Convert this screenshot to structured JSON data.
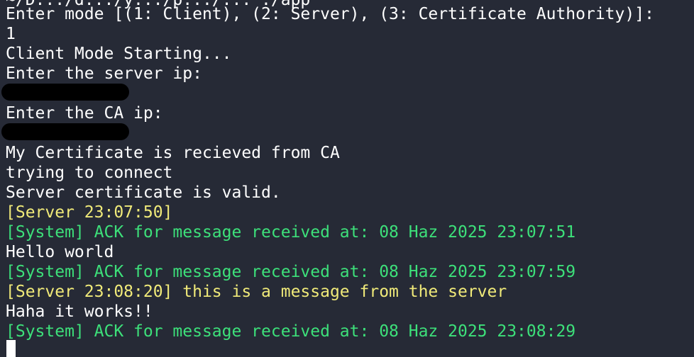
{
  "colors": {
    "background": "#262a36",
    "text": "#ffffff",
    "server_text": "#f0ea79",
    "system_text": "#3de07a",
    "redaction": "#000000"
  },
  "terminal": {
    "cut_line": "~/D.../d.../y.../p.../... ./app",
    "mode_prompt": "Enter mode [(1: Client), (2: Server), (3: Certificate Authority)]:",
    "mode_input": "1",
    "client_start": "Client Mode Starting...",
    "server_ip_prompt": "Enter the server ip:",
    "ca_ip_prompt": "Enter the CA ip:",
    "cert_received": "My Certificate is recieved from CA",
    "connecting": "trying to connect",
    "server_cert_valid": "Server certificate is valid.",
    "server_msg_1": "[Server 23:07:50]",
    "system_ack_1": "[System] ACK for message received at: 08 Haz 2025 23:07:51",
    "client_msg_1": "Hello world",
    "system_ack_2": "[System] ACK for message received at: 08 Haz 2025 23:07:59",
    "server_msg_2": "[Server 23:08:20] this is a message from the server",
    "client_msg_2": "Haha it works!!",
    "system_ack_3": "[System] ACK for message received at: 08 Haz 2025 23:08:29"
  }
}
